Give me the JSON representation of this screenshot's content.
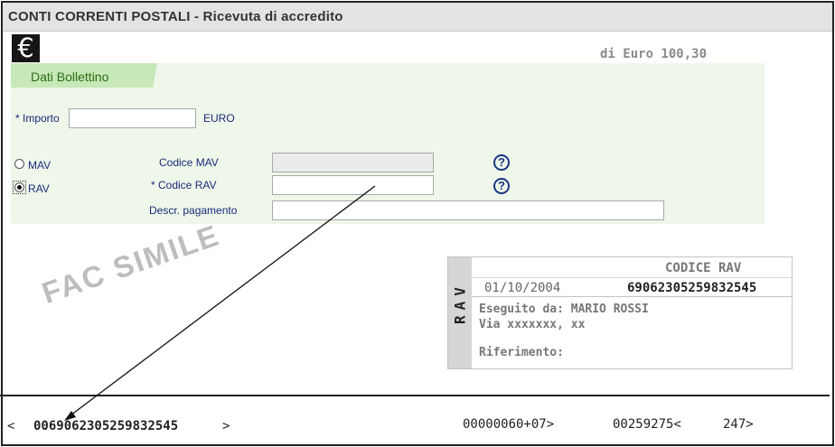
{
  "header": {
    "title": "CONTI CORRENTI POSTALI - Ricevuta di accredito"
  },
  "logo": {
    "icon": "euro-logo-icon",
    "symbol": "€"
  },
  "amount": {
    "text": "di Euro 100,30"
  },
  "section": {
    "label": "Dati Bollettino"
  },
  "form": {
    "importo_label": "* Importo",
    "importo_value": "",
    "currency": "EURO",
    "mav_option": {
      "label": "MAV",
      "selected": false
    },
    "rav_option": {
      "label": "RAV",
      "selected": true
    },
    "codice_mav_label": "Codice MAV",
    "codice_mav_value": "",
    "codice_rav_label": "* Codice RAV",
    "codice_rav_value": "",
    "descr_label": "Descr. pagamento",
    "descr_value": "",
    "help_symbol": "?"
  },
  "watermark": {
    "text": "FAC SIMILE"
  },
  "receipt": {
    "side_label": "RAV",
    "header": "CODICE RAV",
    "date": "01/10/2004",
    "code": "69062305259832545",
    "executed_by": "Eseguito da: MARIO ROSSI",
    "address": "Via xxxxxxx, xx",
    "reference": "Riferimento:"
  },
  "codeline": {
    "left_open": "<",
    "left_code": "0069062305259832545",
    "left_close": ">",
    "amount_code": "00000060+07>",
    "account_code": "00259275<",
    "type_code": "247>"
  },
  "colors": {
    "accent_green": "#c7e8b8",
    "panel_green": "#eef7ea",
    "label_blue": "#1c2a7a"
  }
}
